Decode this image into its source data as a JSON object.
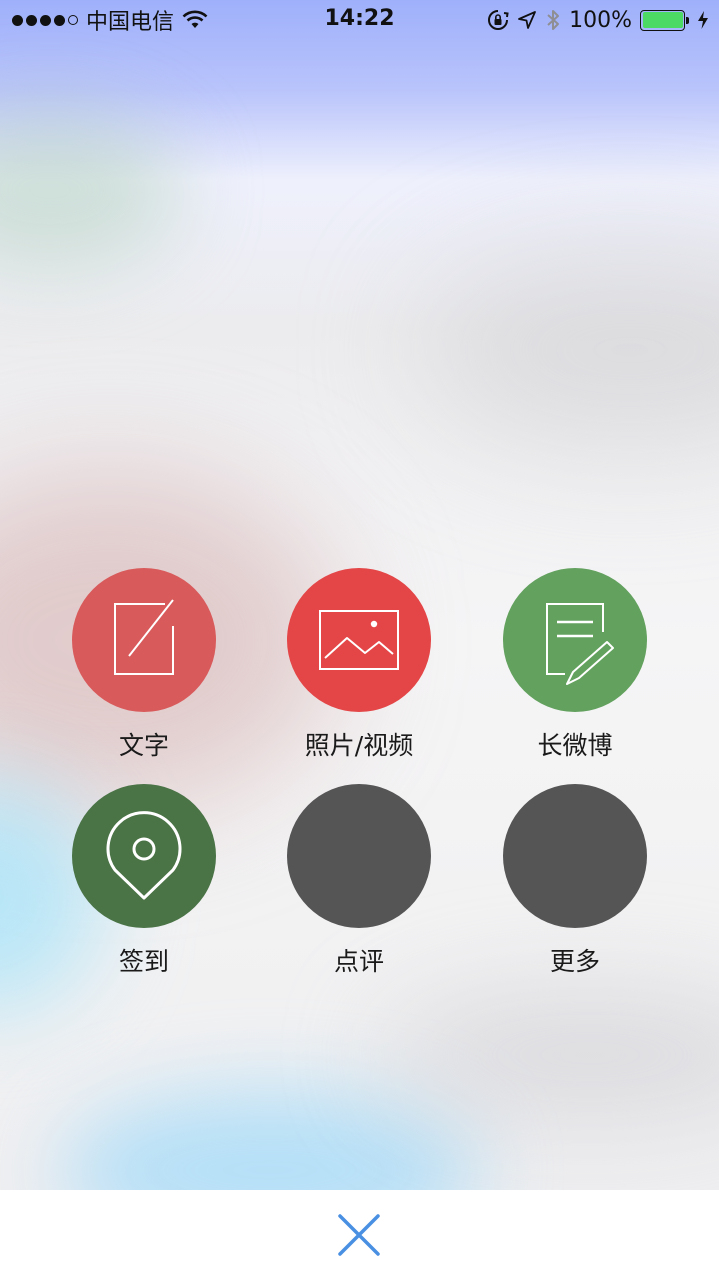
{
  "status_bar": {
    "carrier": "中国电信",
    "time": "14:22",
    "battery_percent": "100%",
    "battery_level": 1.0,
    "battery_color": "#4cd964",
    "signal_bars_filled": 4,
    "icons": [
      "wifi-icon",
      "rotation-lock-icon",
      "location-arrow-icon",
      "bluetooth-icon",
      "charging-bolt-icon"
    ]
  },
  "actions": [
    {
      "label": "文字",
      "icon": "compose-icon",
      "color": "#d95a5b"
    },
    {
      "label": "照片/视频",
      "icon": "photo-icon",
      "color": "#e44647"
    },
    {
      "label": "长微博",
      "icon": "long-post-icon",
      "color": "#63a15e"
    },
    {
      "label": "签到",
      "icon": "location-pin-icon",
      "color": "#4a7346"
    },
    {
      "label": "点评",
      "icon": "",
      "color": "#555555"
    },
    {
      "label": "更多",
      "icon": "",
      "color": "#555555"
    }
  ],
  "bottom_bar": {
    "close_icon": "close-icon",
    "close_color": "#4a90e2"
  }
}
